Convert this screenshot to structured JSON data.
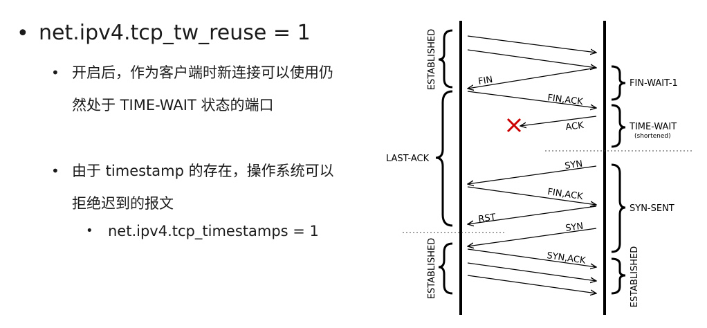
{
  "slide": {
    "bullet1": "net.ipv4.tcp_tw_reuse = 1",
    "sub1": "开启后，作为客户端时新连接可以使用仍然处于 TIME-WAIT 状态的端口",
    "sub2": "由于 timestamp 的存在，操作系统可以拒绝迟到的报文",
    "subsub1": "net.ipv4.tcp_timestamps = 1"
  },
  "diagram": {
    "left_states": {
      "established_top": "ESTABLISHED",
      "last_ack": "LAST-ACK",
      "established_bottom": "ESTABLISHED"
    },
    "right_states": {
      "fin_wait_1": "FIN-WAIT-1",
      "time_wait": "TIME-WAIT",
      "time_wait_note": "(shortened)",
      "syn_sent": "SYN-SENT",
      "established": "ESTABLISHED"
    },
    "messages": {
      "fin": "FIN",
      "fin_ack_1": "FIN,ACK",
      "ack": "ACK",
      "syn_1": "SYN",
      "fin_ack_2": "FIN,ACK",
      "rst": "RST",
      "syn_2": "SYN",
      "syn_ack": "SYN,ACK"
    },
    "lost_marker_color": "#cc0000"
  }
}
